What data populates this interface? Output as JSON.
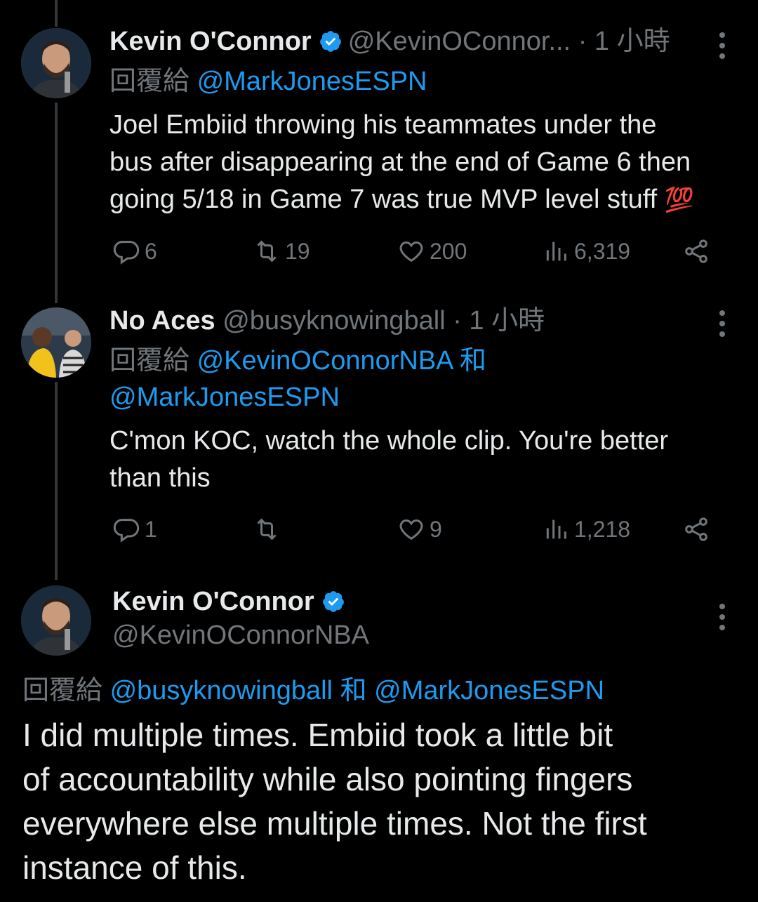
{
  "tweets": [
    {
      "name": "Kevin O'Connor",
      "handle": "@KevinOConnor...",
      "time": "· 1 小時",
      "reply_prefix": "回覆給",
      "reply_to": [
        "@MarkJonesESPN"
      ],
      "text_lines": [
        "Joel Embiid throwing his teammates under the",
        "bus after disappearing at the end of Game 6 then",
        "going 5/18 in Game 7 was true MVP level stuff"
      ],
      "emoji": "💯",
      "actions": {
        "replies": "6",
        "retweets": "19",
        "likes": "200",
        "views": "6,319"
      }
    },
    {
      "name": "No Aces",
      "handle": "@busyknowingball",
      "time": "· 1 小時",
      "reply_prefix": "回覆給",
      "reply_to": [
        "@KevinOConnorNBA",
        "@MarkJonesESPN"
      ],
      "conjunction": "和",
      "text_lines": [
        "C'mon KOC, watch the whole clip. You're better",
        "than this"
      ],
      "actions": {
        "replies": "1",
        "retweets": "",
        "likes": "9",
        "views": "1,218"
      }
    }
  ],
  "main_tweet": {
    "name": "Kevin O'Connor",
    "handle": "@KevinOConnorNBA",
    "reply_prefix": "回覆給",
    "reply_to": [
      "@busyknowingball",
      "@MarkJonesESPN"
    ],
    "conjunction": "和",
    "text_lines": [
      "I did multiple times. Embiid took a little bit",
      "of accountability while also pointing fingers",
      "everywhere else multiple times. Not the first",
      "instance of this."
    ]
  },
  "colors": {
    "background": "#000000",
    "text": "#e7e9ea",
    "muted": "#71767b",
    "link": "#1d9bf0",
    "verified": "#1d9bf0"
  }
}
